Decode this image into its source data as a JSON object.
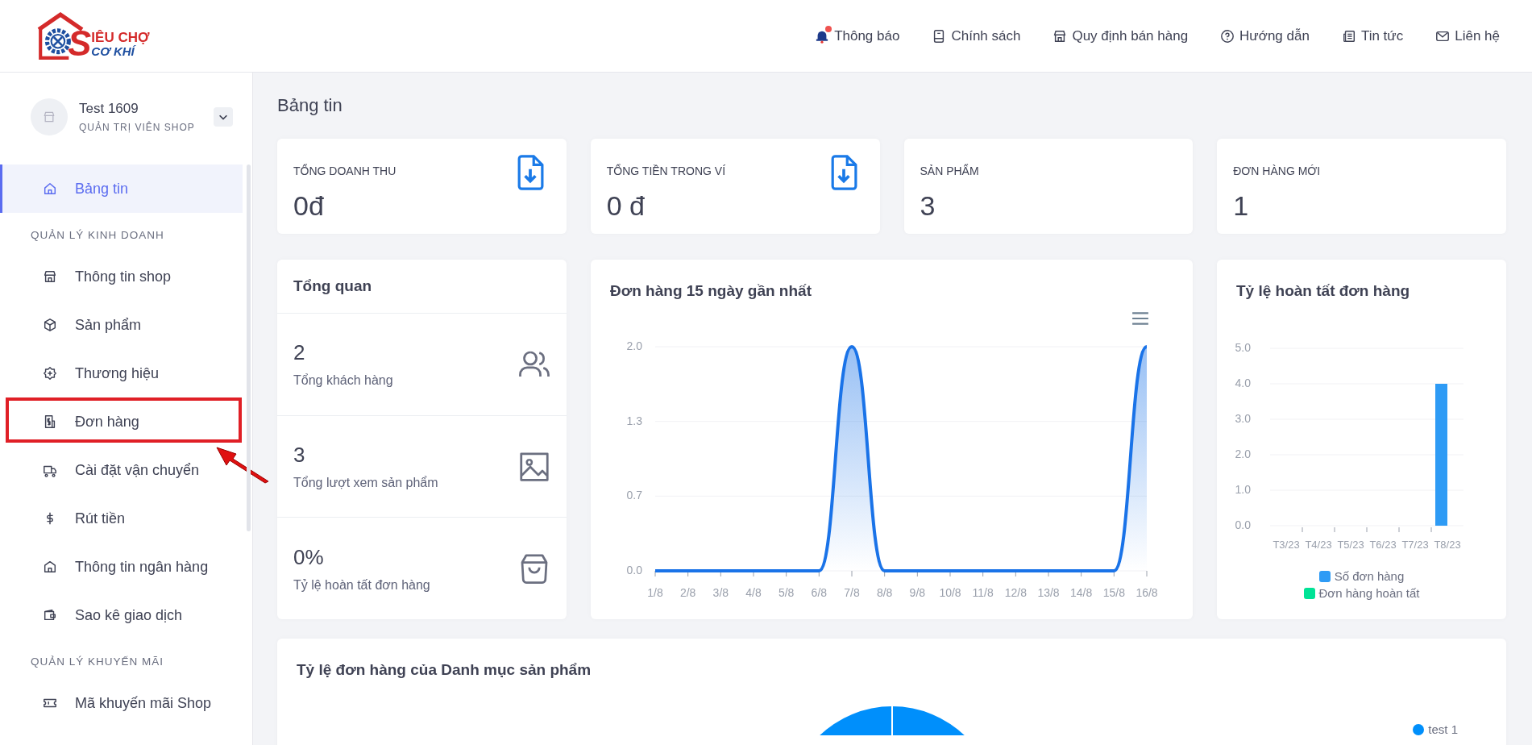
{
  "logo": {
    "line1": "IÊU CHỢ",
    "line2": "CƠ KHÍ",
    "letter": "S"
  },
  "top_nav": [
    {
      "label": "Thông báo",
      "badge_dot": true
    },
    {
      "label": "Chính sách",
      "badge_dot": false
    },
    {
      "label": "Quy định bán hàng",
      "badge_dot": false
    },
    {
      "label": "Hướng dẫn",
      "badge_dot": false
    },
    {
      "label": "Tin tức",
      "badge_dot": false
    },
    {
      "label": "Liên hệ",
      "badge_dot": false
    }
  ],
  "user": {
    "name": "Test 1609",
    "role": "QUẢN TRỊ VIÊN SHOP"
  },
  "sidebar": {
    "items": [
      {
        "kind": "item",
        "label": "Bảng tin",
        "selected": true,
        "highlighted": false
      },
      {
        "kind": "section",
        "label": "QUẢN LÝ KINH DOANH"
      },
      {
        "kind": "item",
        "label": "Thông tin shop",
        "selected": false,
        "highlighted": false
      },
      {
        "kind": "item",
        "label": "Sản phẩm",
        "selected": false,
        "highlighted": false
      },
      {
        "kind": "item",
        "label": "Thương hiệu",
        "selected": false,
        "highlighted": false
      },
      {
        "kind": "item",
        "label": "Đơn hàng",
        "selected": false,
        "highlighted": true
      },
      {
        "kind": "item",
        "label": "Cài đặt vận chuyển",
        "selected": false,
        "highlighted": false
      },
      {
        "kind": "item",
        "label": "Rút tiền",
        "selected": false,
        "highlighted": false
      },
      {
        "kind": "item",
        "label": "Thông tin ngân hàng",
        "selected": false,
        "highlighted": false
      },
      {
        "kind": "item",
        "label": "Sao kê giao dịch",
        "selected": false,
        "highlighted": false
      },
      {
        "kind": "section",
        "label": "QUẢN LÝ KHUYẾN MÃI"
      },
      {
        "kind": "item",
        "label": "Mã khuyến mãi Shop",
        "selected": false,
        "highlighted": false
      }
    ]
  },
  "page_title": "Bảng tin",
  "stats": [
    {
      "label": "TỔNG DOANH THU",
      "value": "0đ",
      "has_icon": true
    },
    {
      "label": "TỔNG TIỀN TRONG VÍ",
      "value": "0 đ",
      "has_icon": true
    },
    {
      "label": "SẢN PHẨM",
      "value": "3",
      "has_icon": false
    },
    {
      "label": "ĐƠN HÀNG MỚI",
      "value": "1",
      "has_icon": false
    }
  ],
  "overview": {
    "title": "Tổng quan",
    "rows": [
      {
        "value": "2",
        "label": "Tổng khách hàng"
      },
      {
        "value": "3",
        "label": "Tổng lượt xem sản phẩm"
      },
      {
        "value": "0%",
        "label": "Tỷ lệ hoàn tất đơn hàng"
      }
    ]
  },
  "orders_chart": {
    "chart_data": {
      "type": "area",
      "title": "Đơn hàng 15 ngày gần nhất",
      "categories": [
        "1/8",
        "2/8",
        "3/8",
        "4/8",
        "5/8",
        "6/8",
        "7/8",
        "8/8",
        "9/8",
        "10/8",
        "11/8",
        "12/8",
        "13/8",
        "14/8",
        "15/8",
        "16/8"
      ],
      "series": [
        {
          "color": "#1a73e8",
          "values": [
            0,
            0,
            0,
            0,
            0,
            0,
            2,
            0,
            0,
            0,
            0,
            0,
            0,
            0,
            0,
            2
          ]
        }
      ],
      "ylim": [
        0,
        2
      ],
      "grid": true,
      "yticks": [
        {
          "value": 0,
          "label": "0.0"
        },
        {
          "value": 0.667,
          "label": "0.7"
        },
        {
          "value": 1.333,
          "label": "1.3"
        },
        {
          "value": 2,
          "label": "2.0"
        }
      ]
    }
  },
  "completion_chart": {
    "chart_data": {
      "type": "bar",
      "title": "Tỷ lệ hoàn tất đơn hàng",
      "categories": [
        "T3/23",
        "T4/23",
        "T5/23",
        "T6/23",
        "T7/23",
        "T8/23"
      ],
      "series": [
        {
          "name": "Số đơn hàng",
          "color": "#2e9bf5",
          "values": [
            0,
            0,
            0,
            0,
            0,
            4
          ]
        },
        {
          "name": "Đơn hàng hoàn tất",
          "color": "#00e396",
          "values": [
            0,
            0,
            0,
            0,
            0,
            0
          ]
        }
      ],
      "ylim": [
        0,
        5
      ],
      "grid": true,
      "yticks": [
        {
          "value": 0,
          "label": "0.0"
        },
        {
          "value": 1,
          "label": "1.0"
        },
        {
          "value": 2,
          "label": "2.0"
        },
        {
          "value": 3,
          "label": "3.0"
        },
        {
          "value": 4,
          "label": "4.0"
        },
        {
          "value": 5,
          "label": "5.0"
        }
      ]
    }
  },
  "category_share": {
    "title": "Tỷ lệ đơn hàng của Danh mục sản phẩm",
    "legend": [
      {
        "name": "test 1",
        "color": "#008ffb"
      }
    ]
  }
}
